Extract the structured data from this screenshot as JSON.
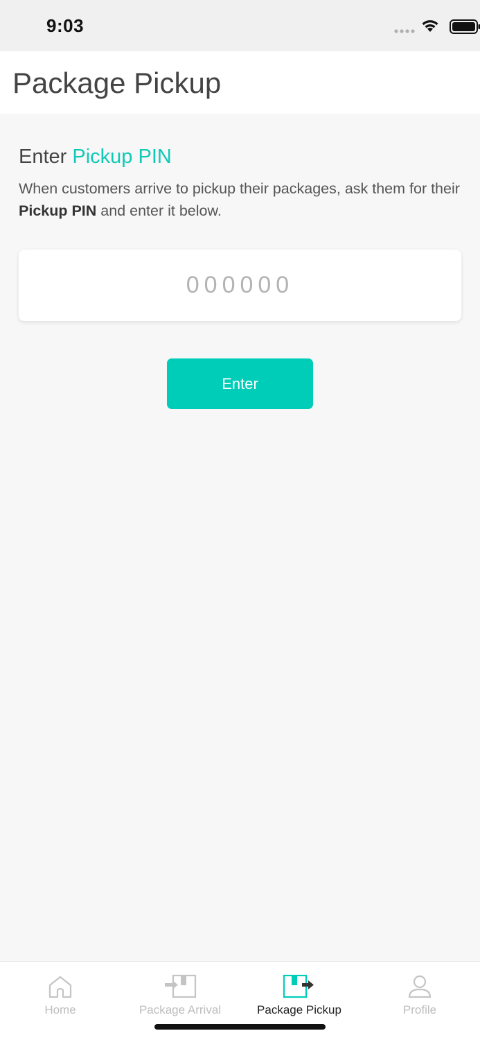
{
  "status_bar": {
    "time": "9:03",
    "icons": [
      "cellular-signal-icon",
      "wifi-icon",
      "battery-icon"
    ]
  },
  "header": {
    "title": "Package Pickup"
  },
  "main": {
    "heading_prefix": "Enter",
    "heading_accent": "Pickup PIN",
    "description_part1": "When customers arrive to pickup their packages, ask them for their ",
    "description_bold": "Pickup PIN",
    "description_part2": " and enter it below.",
    "pin_input": {
      "value": "",
      "placeholder": "000000"
    },
    "enter_button_label": "Enter"
  },
  "tab_bar": {
    "tabs": [
      {
        "label": "Home",
        "icon": "home-icon",
        "active": false
      },
      {
        "label": "Package Arrival",
        "icon": "package-arrival-icon",
        "active": false
      },
      {
        "label": "Package Pickup",
        "icon": "package-pickup-icon",
        "active": true
      },
      {
        "label": "Profile",
        "icon": "profile-icon",
        "active": false
      }
    ]
  },
  "colors": {
    "accent": "#00cdb8",
    "accent_text": "#10c9b7",
    "background": "#f7f7f7",
    "inactive_tab": "#bdbdbd",
    "active_tab": "#222222"
  }
}
